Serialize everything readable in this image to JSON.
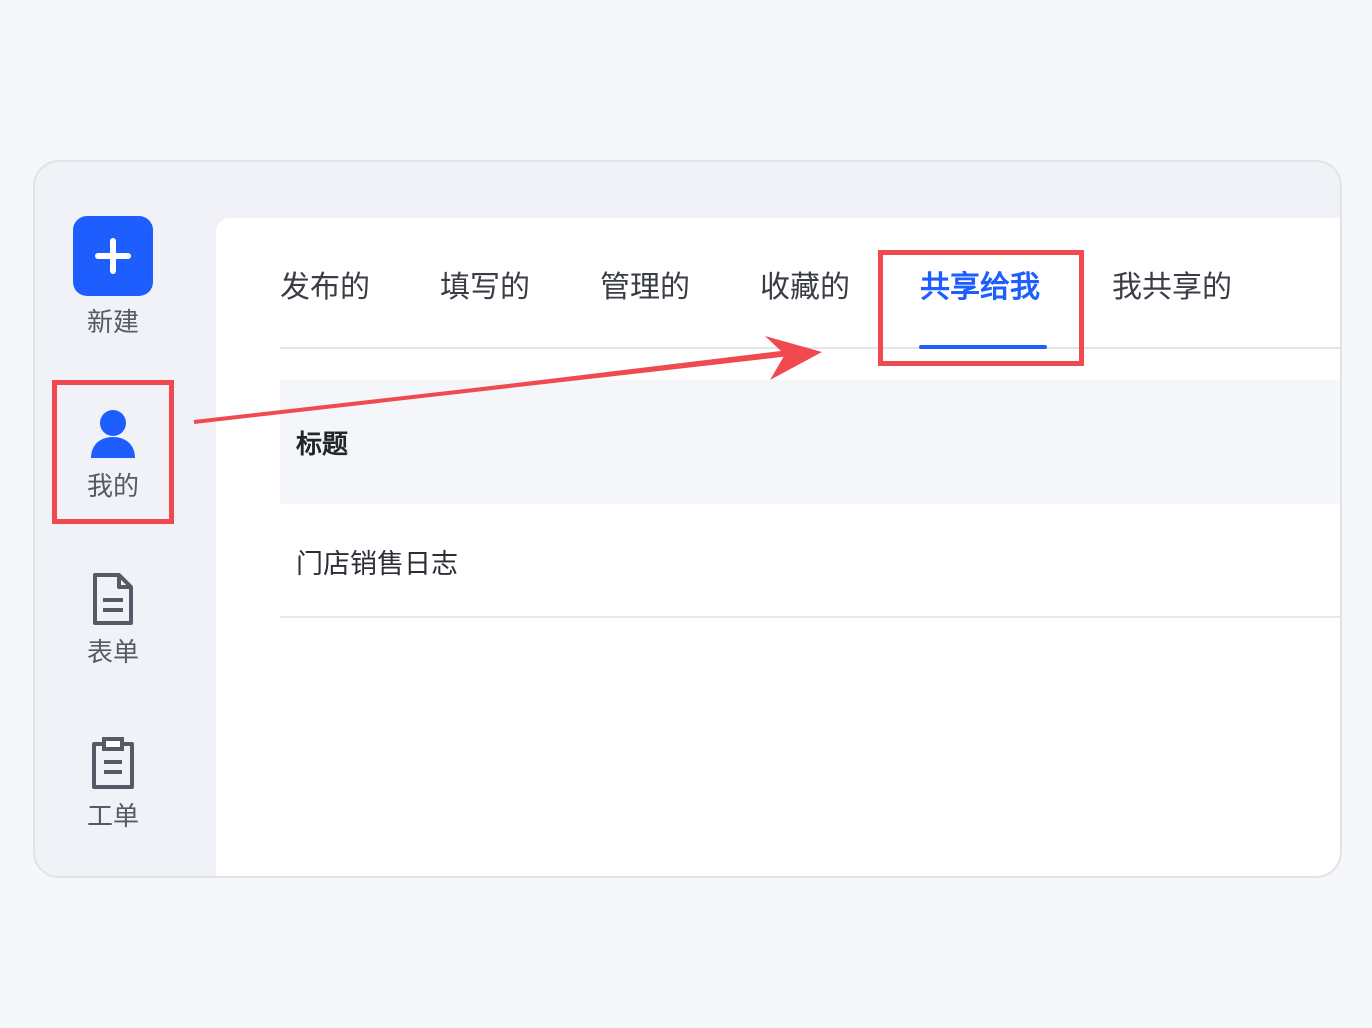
{
  "sidebar": {
    "items": [
      {
        "id": "new",
        "label": "新建",
        "icon": "plus-icon"
      },
      {
        "id": "mine",
        "label": "我的",
        "icon": "user-icon"
      },
      {
        "id": "forms",
        "label": "表单",
        "icon": "document-icon"
      },
      {
        "id": "tickets",
        "label": "工单",
        "icon": "clipboard-icon"
      }
    ]
  },
  "tabs": [
    {
      "label": "发布的",
      "active": false
    },
    {
      "label": "填写的",
      "active": false
    },
    {
      "label": "管理的",
      "active": false
    },
    {
      "label": "收藏的",
      "active": false
    },
    {
      "label": "共享给我",
      "active": true
    },
    {
      "label": "我共享的",
      "active": false
    }
  ],
  "table": {
    "columns": [
      "标题"
    ],
    "rows": [
      {
        "title": "门店销售日志"
      }
    ]
  },
  "colors": {
    "accent": "#1e5eff",
    "highlight": "#f0494f",
    "sidebar_bg": "#f1f2f7",
    "page_bg": "#f6f7f9"
  }
}
